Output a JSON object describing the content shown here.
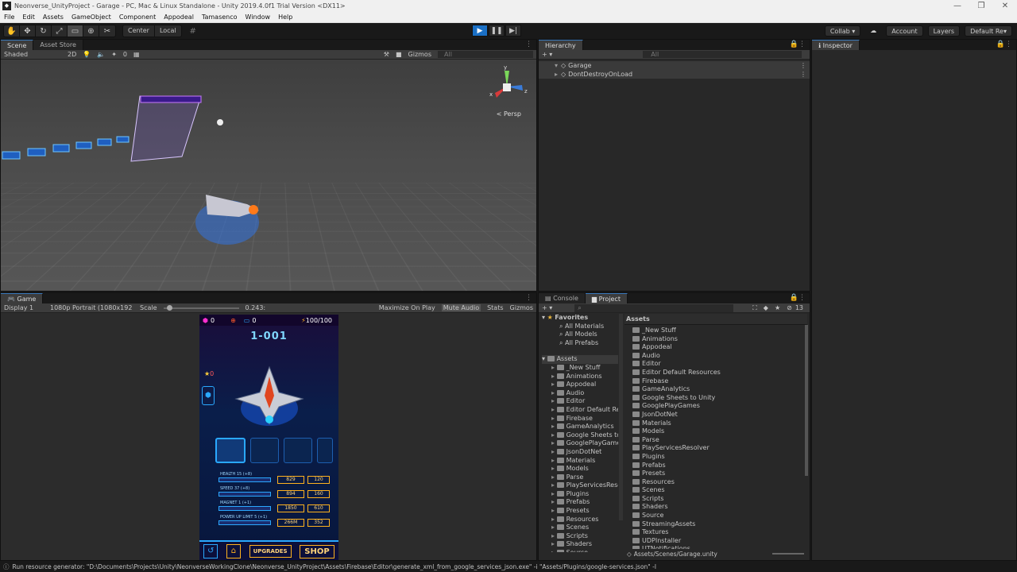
{
  "window": {
    "title": "Neonverse_UnityProject - Garage - PC, Mac & Linux Standalone - Unity 2019.4.0f1 Trial Version <DX11>",
    "minimize": "—",
    "restore": "❐",
    "close": "✕"
  },
  "menu": [
    "File",
    "Edit",
    "Assets",
    "GameObject",
    "Component",
    "Appodeal",
    "Tamasenco",
    "Window",
    "Help"
  ],
  "toolbar": {
    "pivot": "Center",
    "space": "Local",
    "collab": "Collab ▾",
    "account": "Account",
    "layers": "Layers",
    "layout": "Default Re▾"
  },
  "scene_panel": {
    "tabs": [
      "Scene",
      "Asset Store"
    ],
    "shading": "Shaded",
    "mode_2d": "2D",
    "gizmos": "Gizmos",
    "search_placeholder": "All",
    "persp": "< Persp",
    "fx_count": "0"
  },
  "hierarchy": {
    "tab": "Hierarchy",
    "search_placeholder": "All",
    "items": [
      "Garage",
      "DontDestroyOnLoad"
    ]
  },
  "inspector": {
    "tab": "Inspector"
  },
  "game_panel": {
    "tab": "Game",
    "display": "Display 1",
    "resolution": "1080p Portrait (1080x192",
    "scale_label": "Scale",
    "scale_value": "0.243:",
    "maximize": "Maximize On Play",
    "mute": "Mute Audio",
    "stats": "Stats",
    "gizmos": "Gizmos"
  },
  "game": {
    "gems": "0",
    "coins": "0",
    "energy": "100/100",
    "level": "1-001",
    "stars": "0",
    "stats": [
      {
        "label": "HEALTH 15 (+8)",
        "cost1": "829",
        "cost2": "120"
      },
      {
        "label": "SPEED 37 (+8)",
        "cost1": "894",
        "cost2": "160"
      },
      {
        "label": "MAGNET 1 (+1)",
        "cost1": "1850",
        "cost2": "610"
      },
      {
        "label": "POWER UP LIMIT 5 (+1)",
        "cost1": "266M",
        "cost2": "352"
      }
    ],
    "upgrades_button": "UPGRADES",
    "shop_button": "SHOP"
  },
  "project_panel": {
    "tabs": [
      "Console",
      "Project"
    ],
    "hidden_count": "13",
    "favorites_label": "Favorites",
    "favorites": [
      "All Materials",
      "All Models",
      "All Prefabs"
    ],
    "assets_label": "Assets",
    "tree": [
      "_New Stuff",
      "Animations",
      "Appodeal",
      "Audio",
      "Editor",
      "Editor Default Res",
      "Firebase",
      "GameAnalytics",
      "Google Sheets to",
      "GooglePlayGame",
      "JsonDotNet",
      "Materials",
      "Models",
      "Parse",
      "PlayServicesResc",
      "Plugins",
      "Prefabs",
      "Presets",
      "Resources",
      "Scenes",
      "Scripts",
      "Shaders",
      "Source"
    ],
    "breadcrumb": "Assets",
    "folders": [
      "_New Stuff",
      "Animations",
      "Appodeal",
      "Audio",
      "Editor",
      "Editor Default Resources",
      "Firebase",
      "GameAnalytics",
      "Google Sheets to Unity",
      "GooglePlayGames",
      "JsonDotNet",
      "Materials",
      "Models",
      "Parse",
      "PlayServicesResolver",
      "Plugins",
      "Prefabs",
      "Presets",
      "Resources",
      "Scenes",
      "Scripts",
      "Shaders",
      "Source",
      "StreamingAssets",
      "Textures",
      "UDPInstaller",
      "UTNotifications"
    ],
    "path": "Assets/Scenes/Garage.unity"
  },
  "status": "Run resource generator: \"D:\\Documents\\Projects\\Unity\\NeonverseWorkingClone\\Neonverse_UnityProject\\Assets\\Firebase\\Editor\\generate_xml_from_google_services_json.exe\" -i \"Assets/Plugins/google-services.json\" -l",
  "colors": {
    "accent": "#1a6fc4",
    "panel": "#282828",
    "neon_pink": "#ff2fd0",
    "neon_blue": "#2aa8ff",
    "gold": "#ffb21e"
  }
}
